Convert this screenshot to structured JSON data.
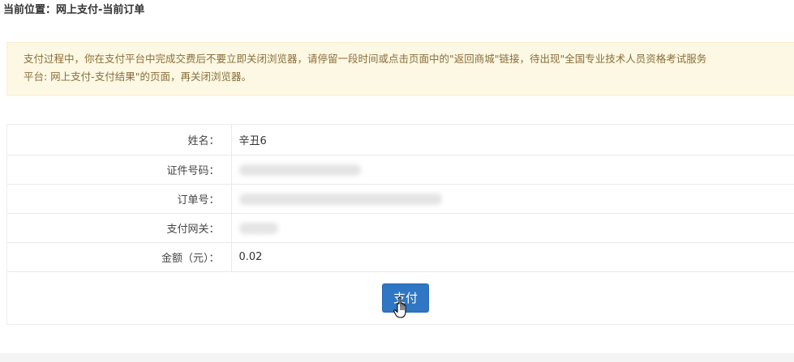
{
  "breadcrumb": {
    "text": "当前位置：网上支付-当前订单"
  },
  "notice": {
    "line1": "支付过程中，你在支付平台中完成交费后不要立即关闭浏览器，请停留一段时间或点击页面中的\"返回商城\"链接，待出现\"全国专业技术人员资格考试服务",
    "line2": "平台: 网上支付-支付结果\"的页面，再关闭浏览器。"
  },
  "order": {
    "rows": [
      {
        "label": "姓名：",
        "value": "辛丑6",
        "redacted": false
      },
      {
        "label": "证件号码：",
        "value": "",
        "redacted": true
      },
      {
        "label": "订单号：",
        "value": "",
        "redacted": true
      },
      {
        "label": "支付网关：",
        "value": "",
        "redacted": true
      },
      {
        "label": "金额（元）：",
        "value": "0.02",
        "redacted": false
      }
    ]
  },
  "actions": {
    "pay_label": "支付"
  },
  "icons": {
    "cursor": "hand-pointer-icon"
  },
  "colors": {
    "primary": "#2f76c4",
    "notice_bg": "#fcf8e3",
    "notice_text": "#8a6d3b"
  }
}
